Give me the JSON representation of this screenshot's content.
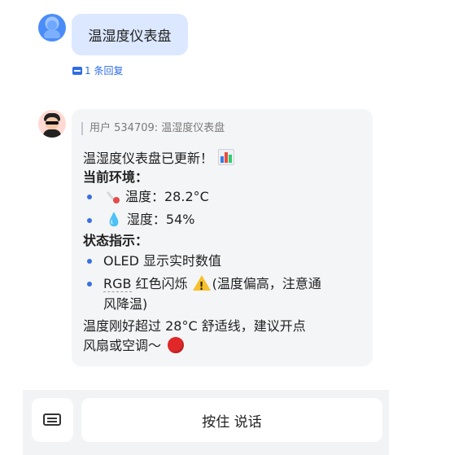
{
  "user_message": {
    "text": "温湿度仪表盘"
  },
  "reply_link": {
    "text": "1 条回复"
  },
  "bot_message": {
    "quote": "用户 534709: 温湿度仪表盘",
    "line1": "温湿度仪表盘已更新！",
    "section1_title": "当前环境：",
    "temp_text": "温度：28.2°C",
    "humidity_text": "湿度：54%",
    "section2_title": "状态指示：",
    "status1": "OLED 显示实时数值",
    "status2_prefix": "RGB",
    "status2_text": " 红色闪烁",
    "status2_note_line1": "(温度偏高，注意通",
    "status2_note_line2": "风降温)",
    "summary_line1": "温度刚好超过 28°C 舒适线，建议开点",
    "summary_line2": "风扇或空调～"
  },
  "input_bar": {
    "hold_to_talk": "按住 说话"
  },
  "icons": {
    "user_avatar": "user-avatar-icon",
    "bot_avatar": "bot-avatar-icon",
    "reply": "comment-icon",
    "chart": "bar-chart-emoji",
    "thermometer": "thermometer-emoji",
    "droplet": "droplet-emoji",
    "warning": "warning-emoji",
    "red_circle": "red-circle-emoji",
    "keyboard": "keyboard-icon"
  },
  "colors": {
    "user_bubble": "#dbe8ff",
    "bot_bubble": "#f4f5f7",
    "link": "#2f6de5",
    "bullet": "#3a6fe0"
  }
}
